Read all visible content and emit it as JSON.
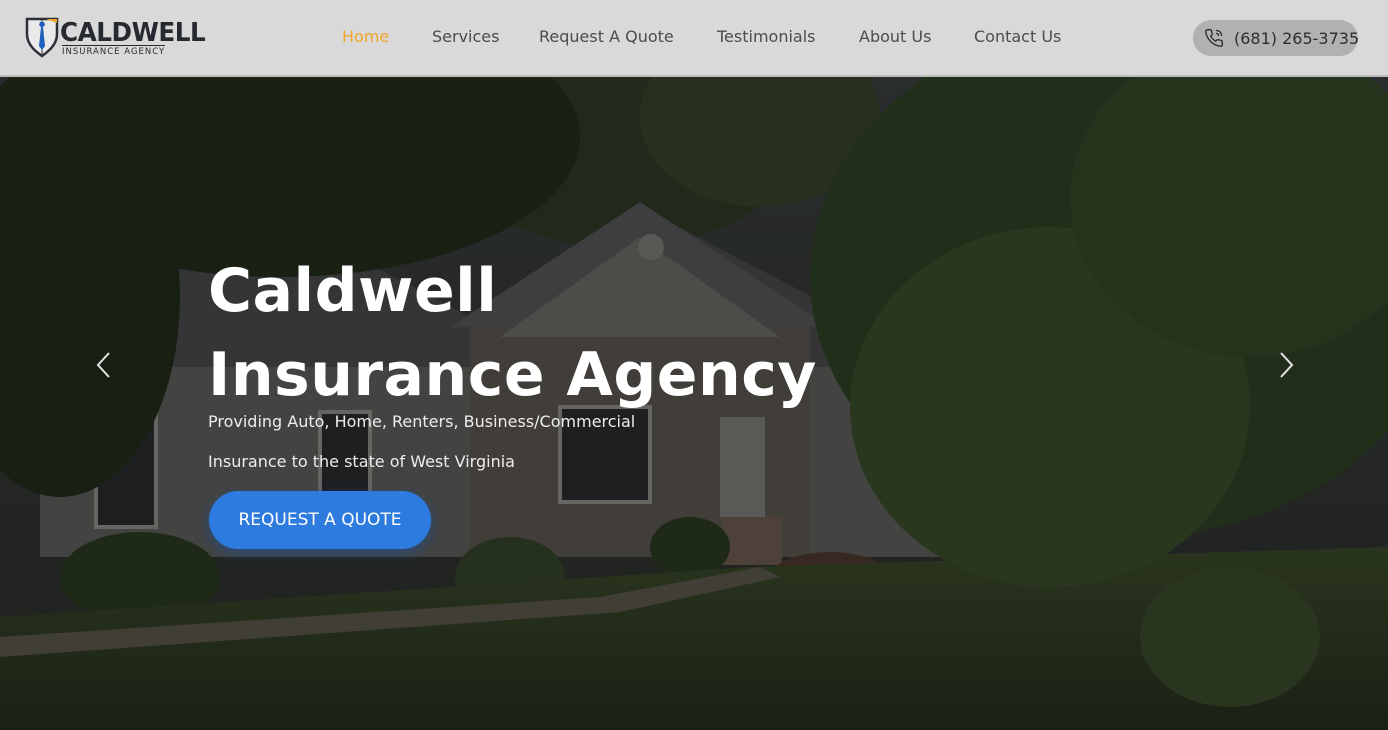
{
  "brand": {
    "name": "CALDWELL",
    "tagline": "INSURANCE AGENCY"
  },
  "nav": {
    "items": [
      {
        "label": "Home",
        "active": true
      },
      {
        "label": "Services"
      },
      {
        "label": "Request A Quote"
      },
      {
        "label": "Testimonials"
      },
      {
        "label": "About Us"
      },
      {
        "label": "Contact Us"
      }
    ],
    "active_color": "#f0a52a",
    "text_color": "#4c4c4c"
  },
  "phone": {
    "icon": "phone-icon",
    "number": "(681) 265-3735"
  },
  "hero": {
    "title_line_1": "Caldwell",
    "title_line_2": "Insurance Agency",
    "subtitle_line_1": "Providing Auto, Home, Renters, Business/Commercial",
    "subtitle_line_2": "Insurance to the state of West Virginia",
    "cta_label": "REQUEST A QUOTE",
    "cta_color": "#2d7bde",
    "prev_icon": "chevron-left-icon",
    "next_icon": "chevron-right-icon"
  }
}
